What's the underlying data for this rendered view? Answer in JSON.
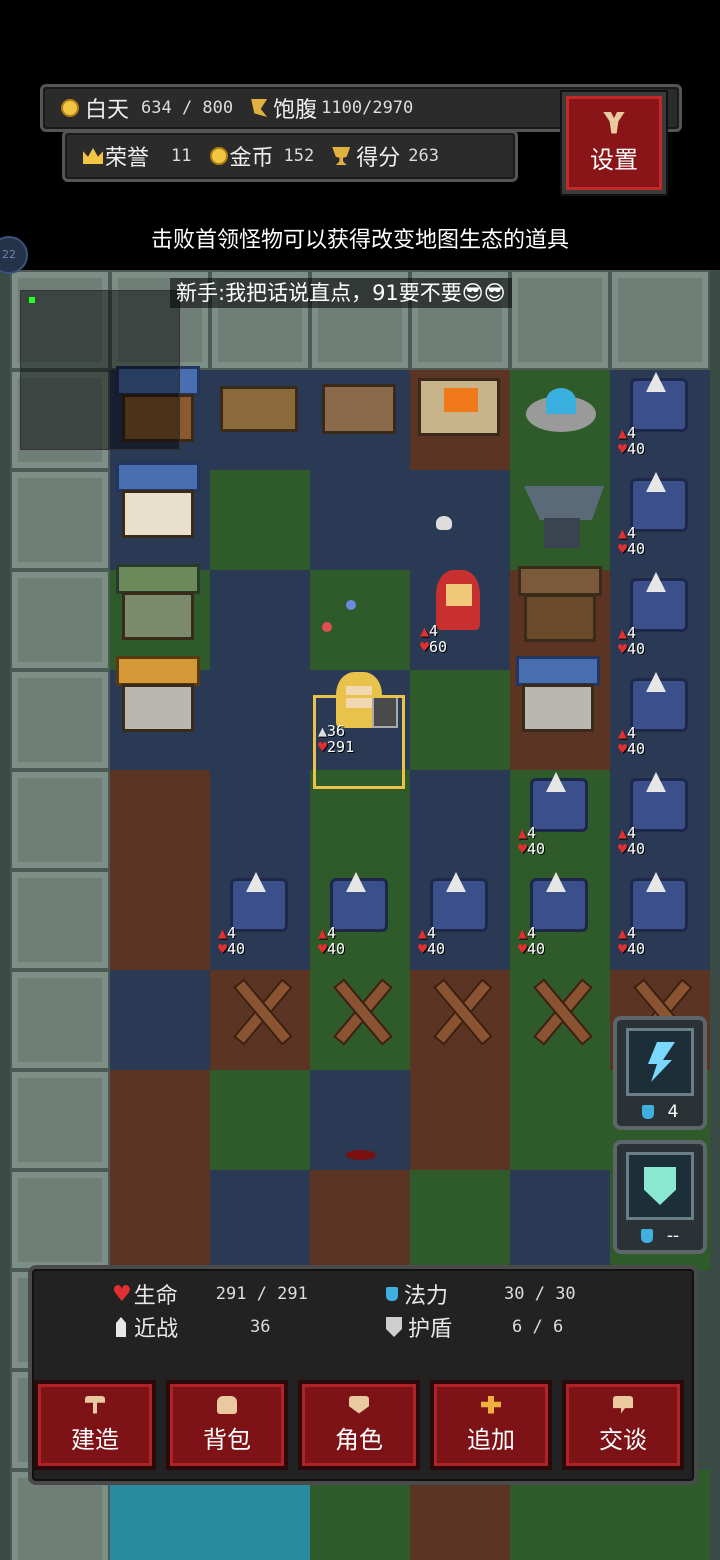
{
  "hud": {
    "day_label": "白天",
    "day_value": "634 / 800",
    "hunger_label": "饱腹",
    "hunger_value": "1100/2970",
    "honor_label": "荣誉",
    "honor_value": "11",
    "gold_label": "金币",
    "gold_value": "152",
    "score_label": "得分",
    "score_value": "263",
    "settings_label": "设置"
  },
  "tip": "击败首领怪物可以获得改变地图生态的道具",
  "chat_message": "新手:我把话说直点，91要不要😎😎",
  "side_badge": "22",
  "units": {
    "hero_attack": "36",
    "hero_hp": "291",
    "red_hood_attack": "4",
    "red_hood_hp": "60",
    "ballista_attack": "4",
    "ballista_hp": "40"
  },
  "skills": [
    {
      "icon": "lightning-icon",
      "cost": "4"
    },
    {
      "icon": "shield-icon",
      "cost": "--"
    }
  ],
  "stats": {
    "hp_label": "生命",
    "hp_value": "291 / 291",
    "mana_label": "法力",
    "mana_value": "30 / 30",
    "melee_label": "近战",
    "melee_value": "36",
    "shield_label": "护盾",
    "shield_value": "6 / 6"
  },
  "buttons": {
    "build": "建造",
    "bag": "背包",
    "character": "角色",
    "add": "追加",
    "talk": "交谈"
  },
  "colors": {
    "accent_red": "#8a1518",
    "gold": "#f2c542",
    "selection": "#e8c24a"
  }
}
